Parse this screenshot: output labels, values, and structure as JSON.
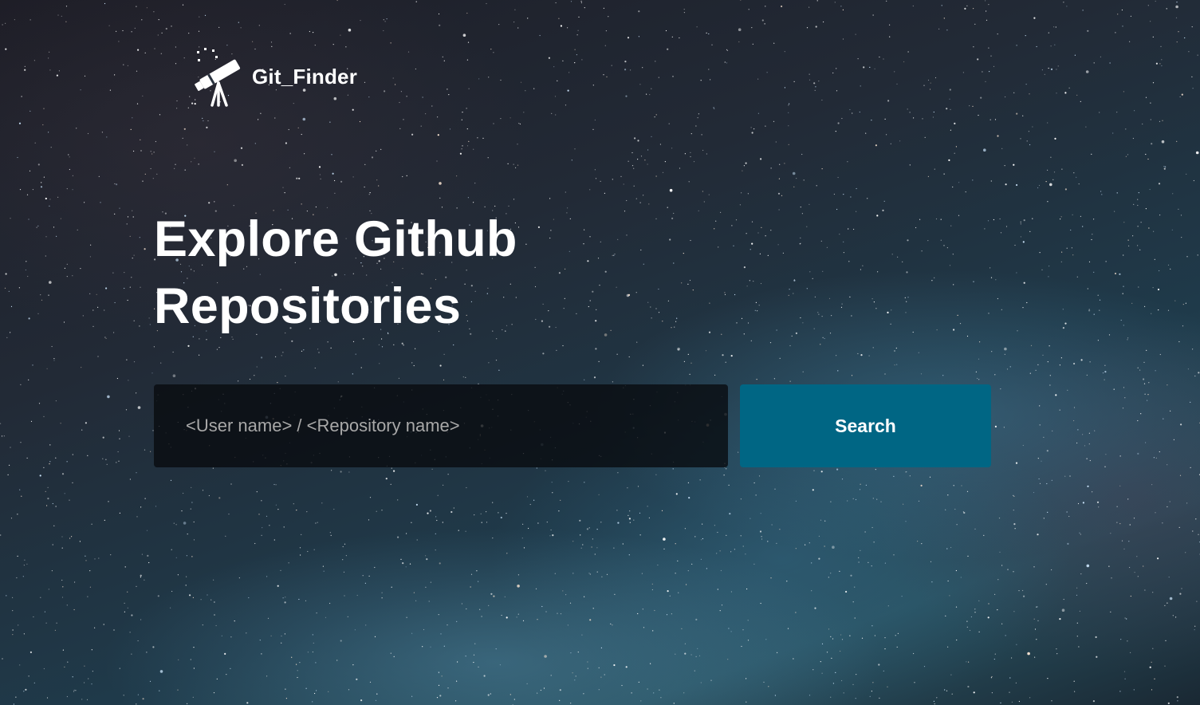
{
  "brand": {
    "name": "Git_Finder",
    "icon": "telescope-icon"
  },
  "hero": {
    "title_line1": "Explore Github",
    "title_line2": "Repositories"
  },
  "search": {
    "placeholder": "<User name> / <Repository name>",
    "value": "",
    "button_label": "Search"
  },
  "colors": {
    "accent": "#006684",
    "input_background": "#0a0c10",
    "text": "#ffffff"
  }
}
